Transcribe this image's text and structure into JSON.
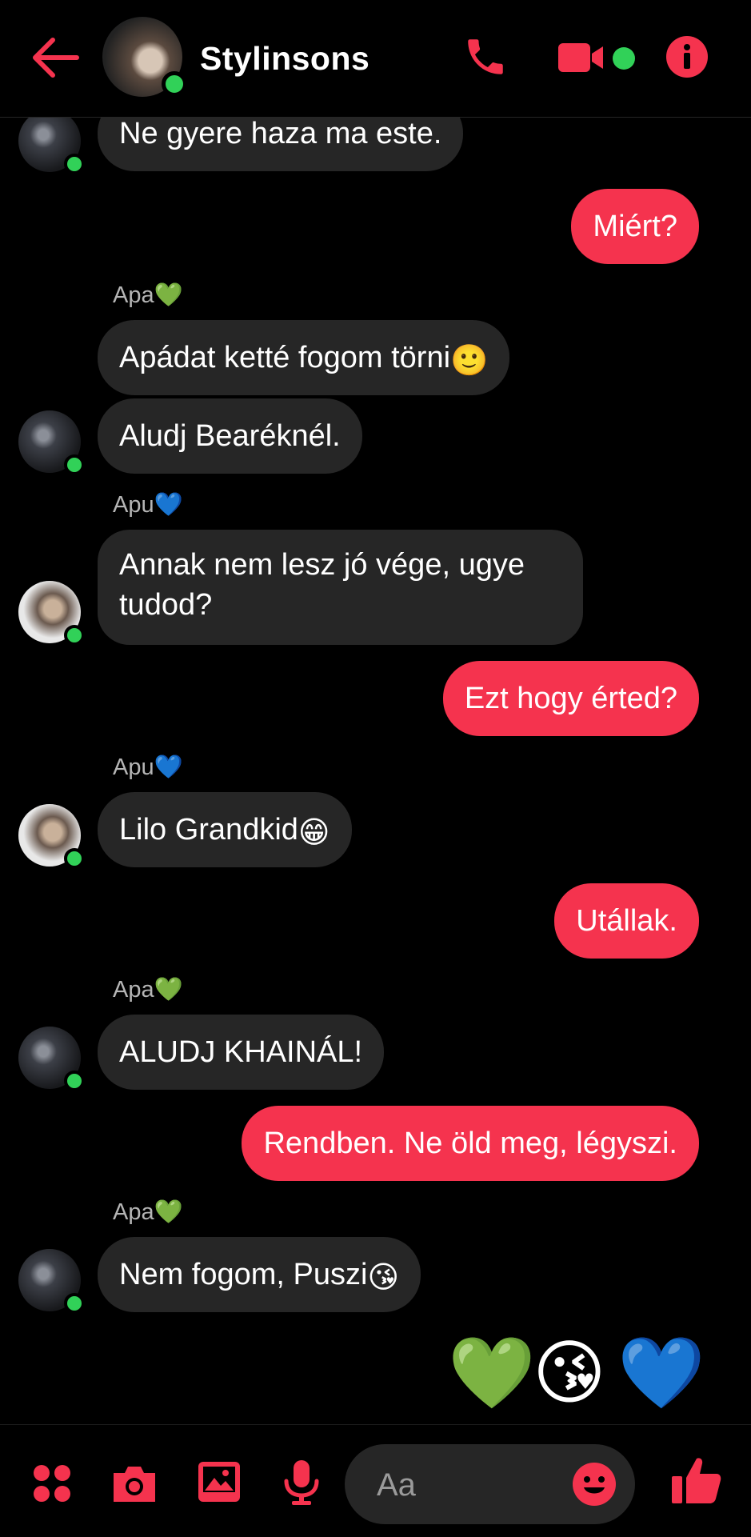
{
  "header": {
    "title": "Stylinsons",
    "accent_color": "#f5334e",
    "online_color": "#31d158",
    "icons": [
      "back-arrow-icon",
      "phone-icon",
      "video-camera-icon",
      "info-icon"
    ]
  },
  "messages": [
    {
      "from": "Apa",
      "text": "Ne gyere haza ma este."
    },
    {
      "from": "me",
      "text": "Miért?"
    },
    {
      "from": "Apa",
      "label": "Apa💚",
      "text": "Apádat ketté fogom törni",
      "emoji": "🙂"
    },
    {
      "from": "Apa",
      "text": "Aludj Bearéknél."
    },
    {
      "from": "Apu",
      "label": "Apu💙",
      "text": "Annak nem lesz jó vége, ugye tudod?"
    },
    {
      "from": "me",
      "text": "Ezt hogy érted?"
    },
    {
      "from": "Apu",
      "label": "Apu💙",
      "text": "Lilo Grandkid",
      "emoji": "😁"
    },
    {
      "from": "me",
      "text": "Utállak."
    },
    {
      "from": "Apa",
      "label": "Apa💚",
      "text": "ALUDJ KHAINÁL!"
    },
    {
      "from": "me",
      "text": "Rendben. Ne öld meg, légyszi."
    },
    {
      "from": "Apa",
      "label": "Apa💚",
      "text": "Nem fogom, Puszi",
      "emoji": "😘"
    },
    {
      "from": "me",
      "emojis": [
        "💚",
        "😘",
        "💙"
      ]
    }
  ],
  "composer": {
    "placeholder": "Aa",
    "icons": [
      "apps-icon",
      "camera-icon",
      "image-icon",
      "microphone-icon",
      "emoji-icon",
      "thumbs-up-icon"
    ]
  }
}
